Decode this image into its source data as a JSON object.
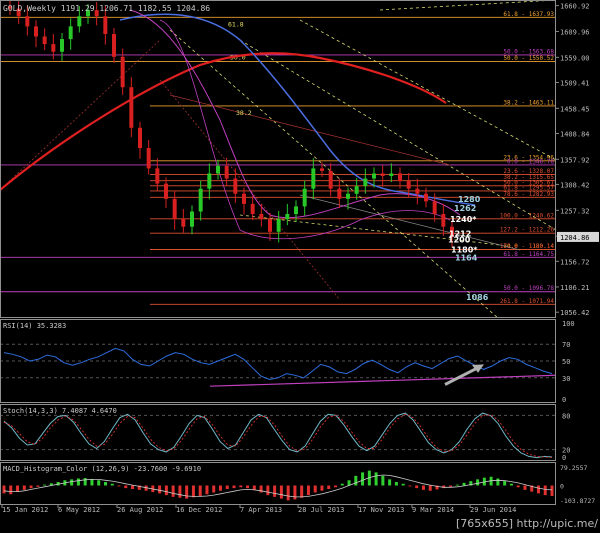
{
  "chart_data": {
    "type": "line",
    "instrument": "GOLD,Weekly",
    "ohlc_readout": "1191.29 1206.71 1182.55 1204.86",
    "current_price": "1204.86",
    "price_axis": [
      "1660.92",
      "1609.96",
      "1559.00",
      "1509.41",
      "1458.45",
      "1408.84",
      "1357.92",
      "1308.42",
      "1257.32",
      "1206.42",
      "1156.72",
      "1106.21",
      "1056.42"
    ],
    "ylim": [
      1045,
      1672
    ],
    "x_labels": [
      "15 Jan 2012",
      "6 May 2012",
      "26 Aug 2012",
      "16 Dec 2012",
      "7 Apr 2013",
      "28 Jul 2013",
      "17 Nov 2013",
      "9 Mar 2014",
      "29 Jun 2014"
    ],
    "fib_levels": [
      {
        "label": "61.8 - 1637.93",
        "price": 1637.93,
        "color": "#f0a030"
      },
      {
        "label": "50.0 - 1563.68",
        "price": 1563.68,
        "color": "#c040c0"
      },
      {
        "label": "50.0 - 1550.52",
        "price": 1550.52,
        "color": "#f0a030"
      },
      {
        "label": "38.2 - 1463.11",
        "price": 1463.11,
        "color": "#f0a030"
      },
      {
        "label": "23.6 - 1354.96",
        "price": 1354.96,
        "color": "#f0a030"
      },
      {
        "label": "0.0 - 1346.78",
        "price": 1346.78,
        "color": "#c040c0"
      },
      {
        "label": "23.6 - 1328.07",
        "price": 1328.07,
        "color": "#e05030"
      },
      {
        "label": "38.2 - 1315.65",
        "price": 1315.65,
        "color": "#e05030"
      },
      {
        "label": "50.0 - 1305.61",
        "price": 1305.61,
        "color": "#e05030"
      },
      {
        "label": "61.8 - 1295.57",
        "price": 1295.57,
        "color": "#e05030"
      },
      {
        "label": "78.6 - 1282.93",
        "price": 1282.93,
        "color": "#e05030"
      },
      {
        "label": "100.0 - 1240.62",
        "price": 1240.62,
        "color": "#e05030"
      },
      {
        "label": "127.2 - 1212.26",
        "price": 1212.26,
        "color": "#e05030"
      },
      {
        "label": "70.0 - 1180.14",
        "price": 1180.14,
        "color": "#f0a030"
      },
      {
        "label": "161.8 - 1180.14",
        "price": 1180.14,
        "color": "#e05030"
      },
      {
        "label": "61.8 - 1164.75",
        "price": 1164.75,
        "color": "#c040c0"
      },
      {
        "label": "50.0 - 1096.78",
        "price": 1096.78,
        "color": "#c040c0"
      },
      {
        "label": "261.8 - 1071.94",
        "price": 1071.94,
        "color": "#e05030"
      }
    ],
    "annotations": [
      {
        "text": "1280",
        "price": 1280,
        "color": "#a0d0e0"
      },
      {
        "text": "1262",
        "price": 1262,
        "color": "#a0d0e0"
      },
      {
        "text": "1240*",
        "price": 1240,
        "color": "#ffffff"
      },
      {
        "text": "1212",
        "price": 1212,
        "color": "#ffffff"
      },
      {
        "text": "1200",
        "price": 1200,
        "color": "#ffffff"
      },
      {
        "text": "1180*",
        "price": 1180,
        "color": "#ffffff"
      },
      {
        "text": "1164",
        "price": 1164,
        "color": "#a0d0e0"
      },
      {
        "text": "1086",
        "price": 1086,
        "color": "#a0d0e0"
      }
    ],
    "fib_fan_labels": [
      "61.8",
      "50.0",
      "38.2"
    ],
    "price_close": [
      1655,
      1640,
      1620,
      1600,
      1585,
      1570,
      1595,
      1620,
      1640,
      1652,
      1640,
      1605,
      1560,
      1500,
      1420,
      1380,
      1340,
      1310,
      1280,
      1240,
      1225,
      1255,
      1300,
      1330,
      1345,
      1320,
      1290,
      1270,
      1250,
      1240,
      1215,
      1240,
      1250,
      1265,
      1300,
      1340,
      1335,
      1300,
      1280,
      1290,
      1305,
      1320,
      1330,
      1325,
      1330,
      1315,
      1300,
      1290,
      1275,
      1250,
      1225,
      1205
    ],
    "rsi": {
      "label": "RSI(14) 35.3283",
      "axis": [
        "100",
        "70",
        "50",
        "30",
        "0"
      ],
      "values": [
        60,
        58,
        55,
        50,
        52,
        57,
        55,
        48,
        45,
        48,
        52,
        55,
        60,
        65,
        62,
        52,
        46,
        44,
        50,
        56,
        60,
        58,
        52,
        48,
        46,
        50,
        54,
        58,
        52,
        42,
        32,
        28,
        30,
        35,
        33,
        30,
        38,
        46,
        43,
        37,
        35,
        40,
        47,
        51,
        46,
        40,
        36,
        43,
        48,
        44,
        41,
        47,
        53,
        56,
        50,
        45,
        40,
        44,
        50,
        54,
        52,
        46,
        42,
        38,
        35
      ],
      "upper_threshold": 70,
      "mid": 50,
      "lower_threshold": 30
    },
    "stoch": {
      "label": "Stoch(14,3,3) 7.4087 4.6470",
      "axis": [
        "80",
        "20",
        "0"
      ],
      "k": [
        70,
        58,
        40,
        28,
        30,
        48,
        66,
        78,
        80,
        68,
        48,
        30,
        22,
        34,
        56,
        76,
        82,
        72,
        50,
        30,
        20,
        16,
        24,
        44,
        66,
        80,
        76,
        56,
        34,
        22,
        28,
        50,
        72,
        82,
        76,
        56,
        36,
        20,
        16,
        26,
        48,
        70,
        82,
        80,
        64,
        44,
        26,
        18,
        26,
        46,
        66,
        80,
        84,
        72,
        52,
        32,
        20,
        14,
        20,
        34,
        56,
        74,
        84,
        80,
        66,
        44,
        26,
        14,
        8,
        6,
        8,
        7
      ],
      "d": [
        68,
        62,
        48,
        34,
        29,
        40,
        58,
        72,
        79,
        72,
        56,
        38,
        26,
        29,
        46,
        66,
        78,
        76,
        58,
        38,
        24,
        18,
        21,
        36,
        56,
        74,
        78,
        64,
        44,
        28,
        26,
        42,
        62,
        78,
        78,
        64,
        44,
        26,
        18,
        21,
        38,
        60,
        76,
        80,
        70,
        52,
        34,
        22,
        22,
        38,
        58,
        74,
        82,
        76,
        60,
        40,
        24,
        17,
        18,
        28,
        46,
        66,
        80,
        81,
        72,
        54,
        34,
        20,
        12,
        8,
        7,
        6
      ],
      "upper": 80,
      "lower": 20
    },
    "macd": {
      "label": "MACD_Histogram_Color (12,26,9) -23.7600 -9.6910",
      "axis": [
        "79.2557",
        "0",
        "-103.8727"
      ],
      "hist": [
        -18,
        -20,
        -15,
        -10,
        -6,
        -3,
        2,
        5,
        8,
        12,
        14,
        16,
        17,
        15,
        12,
        8,
        4,
        -2,
        -6,
        -8,
        -10,
        -12,
        -15,
        -18,
        -22,
        -26,
        -28,
        -30,
        -27,
        -24,
        -20,
        -16,
        -12,
        -8,
        -6,
        -4,
        -6,
        -10,
        -16,
        -22,
        -26,
        -30,
        -34,
        -32,
        -28,
        -22,
        -16,
        -12,
        -8,
        -4,
        4,
        12,
        22,
        30,
        34,
        30,
        22,
        14,
        8,
        4,
        -2,
        -6,
        -10,
        -12,
        -9,
        -6,
        -3,
        2,
        6,
        10,
        14,
        18,
        20,
        16,
        10,
        4,
        -4,
        -10,
        -14,
        -18,
        -22,
        -24
      ],
      "signal": [
        -12,
        -14,
        -14,
        -12,
        -9,
        -6,
        -3,
        0,
        3,
        6,
        9,
        11,
        13,
        14,
        14,
        12,
        10,
        7,
        4,
        1,
        -2,
        -5,
        -8,
        -11,
        -14,
        -18,
        -21,
        -24,
        -25,
        -25,
        -24,
        -22,
        -19,
        -16,
        -13,
        -10,
        -9,
        -10,
        -12,
        -15,
        -18,
        -21,
        -24,
        -26,
        -26,
        -25,
        -22,
        -19,
        -15,
        -11,
        -6,
        0,
        6,
        12,
        18,
        22,
        24,
        23,
        20,
        16,
        12,
        8,
        4,
        1,
        -2,
        -4,
        -4,
        -3,
        -1,
        2,
        5,
        8,
        11,
        12,
        11,
        9,
        6,
        2,
        -2,
        -6,
        -9,
        -10
      ]
    },
    "watermark": "[765x655] http://upic.me/"
  },
  "colors": {
    "bg": "#000000",
    "up_candle": "#28c828",
    "down_candle": "#d82020",
    "ma_blue": "#4a6ee0",
    "ma_red": "#e02020",
    "ma_magenta": "#c040c0",
    "grid": "#303030",
    "rsi_line": "#2e6ee0",
    "rsi_trend": "#c040c0",
    "stoch_k": "#6fb9c8",
    "stoch_d": "#e03030",
    "macd_up": "#30d030",
    "macd_down": "#e03030",
    "arrow": "#b0b0b0",
    "dashed_yellow": "#d8d870"
  }
}
